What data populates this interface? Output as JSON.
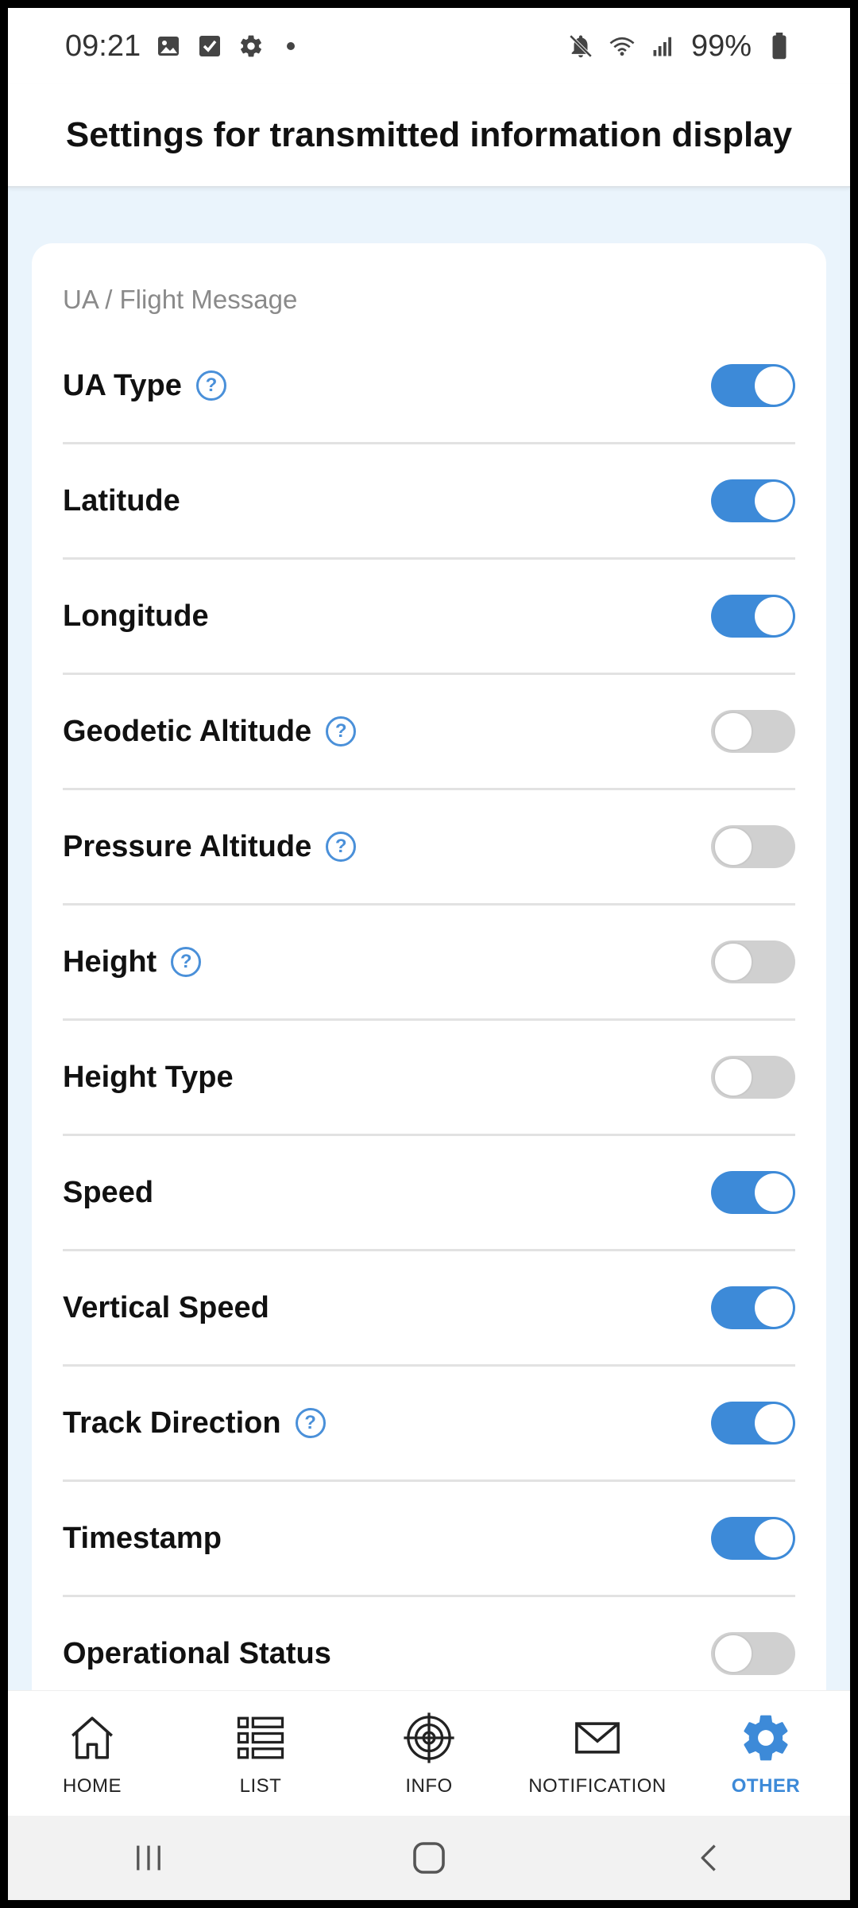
{
  "status_bar": {
    "time": "09:21",
    "battery": "99%",
    "left_icons": [
      "image-icon",
      "checkbox-icon",
      "gear-icon",
      "dot-icon"
    ],
    "right_icons": [
      "mute-icon",
      "wifi-icon",
      "signal-icon",
      "battery-icon"
    ]
  },
  "header": {
    "title": "Settings for transmitted information display"
  },
  "section": {
    "label": "UA / Flight Message"
  },
  "settings": [
    {
      "label": "UA Type",
      "help": true,
      "enabled": true
    },
    {
      "label": "Latitude",
      "help": false,
      "enabled": true
    },
    {
      "label": "Longitude",
      "help": false,
      "enabled": true
    },
    {
      "label": "Geodetic Altitude",
      "help": true,
      "enabled": false
    },
    {
      "label": "Pressure Altitude",
      "help": true,
      "enabled": false
    },
    {
      "label": "Height",
      "help": true,
      "enabled": false
    },
    {
      "label": "Height Type",
      "help": false,
      "enabled": false
    },
    {
      "label": "Speed",
      "help": false,
      "enabled": true
    },
    {
      "label": "Vertical Speed",
      "help": false,
      "enabled": true
    },
    {
      "label": "Track Direction",
      "help": true,
      "enabled": true
    },
    {
      "label": "Timestamp",
      "help": false,
      "enabled": true
    },
    {
      "label": "Operational Status",
      "help": false,
      "enabled": false
    }
  ],
  "help_glyph": "?",
  "bottom_nav": [
    {
      "label": "HOME",
      "icon": "home-icon",
      "active": false
    },
    {
      "label": "LIST",
      "icon": "list-icon",
      "active": false
    },
    {
      "label": "INFO",
      "icon": "radar-icon",
      "active": false
    },
    {
      "label": "NOTIFICATION",
      "icon": "mail-icon",
      "active": false
    },
    {
      "label": "OTHER",
      "icon": "gear-icon",
      "active": true
    }
  ],
  "colors": {
    "accent": "#3d8ad8",
    "toggle_off": "#d0d0d0",
    "background": "#eaf4fc"
  }
}
